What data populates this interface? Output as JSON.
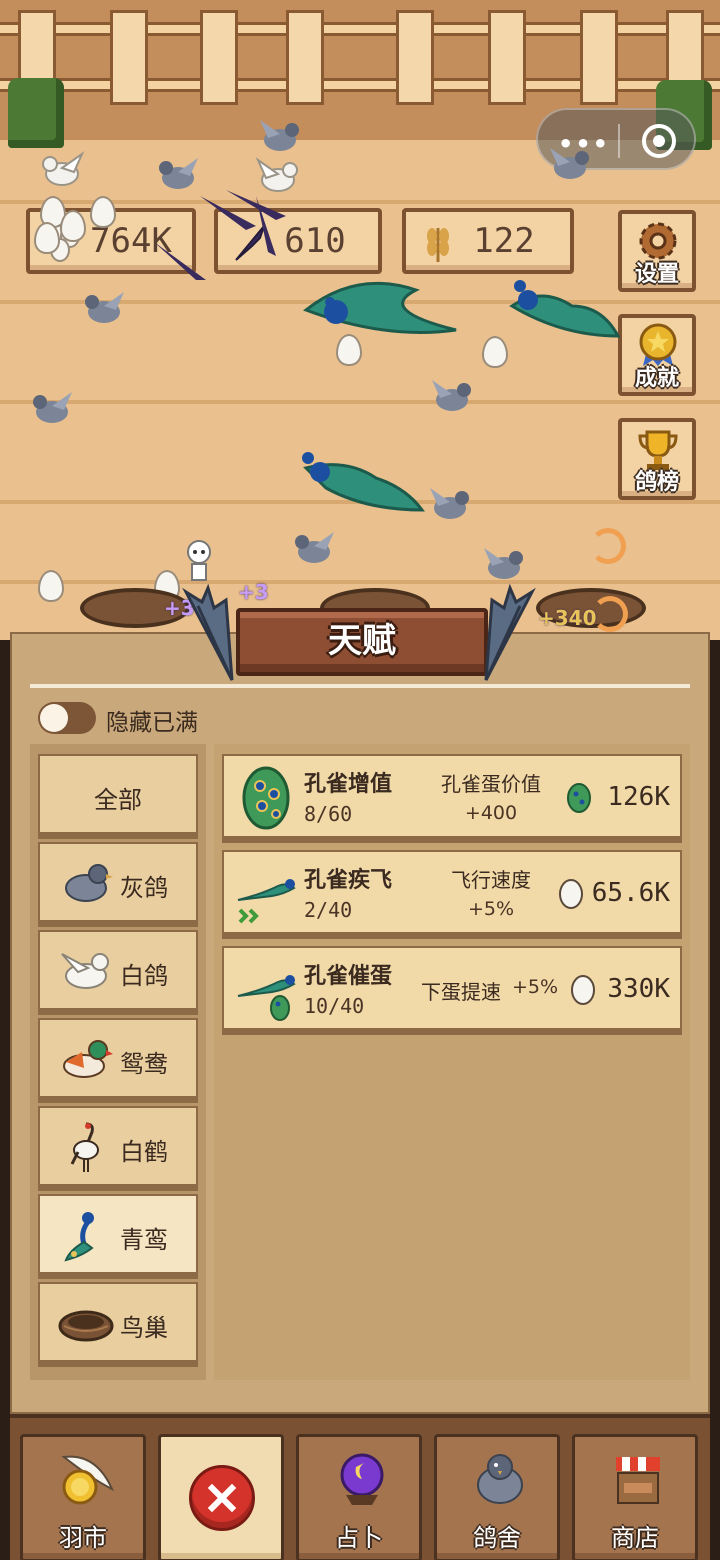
{
  "hud": {
    "eggs": "764K",
    "feathers": "610",
    "grain": "122"
  },
  "side_buttons": {
    "settings": "设置",
    "achievements": "成就",
    "leaderboard": "鸽榜"
  },
  "scene": {
    "floating_texts": [
      "+30",
      "+3",
      "+340"
    ]
  },
  "panel": {
    "title": "天赋",
    "hide_full_label": "隐藏已满",
    "categories": [
      {
        "label": "全部"
      },
      {
        "label": "灰鸽"
      },
      {
        "label": "白鸽"
      },
      {
        "label": "鸳鸯"
      },
      {
        "label": "白鹤"
      },
      {
        "label": "青鸾"
      },
      {
        "label": "鸟巢"
      }
    ],
    "talents": [
      {
        "name": "孔雀增值",
        "level": "8/60",
        "effect": "孔雀蛋价值",
        "effect_value": "+400",
        "price": "126K",
        "price_icon": "peacock-egg-icon"
      },
      {
        "name": "孔雀疾飞",
        "level": "2/40",
        "effect": "飞行速度",
        "effect_value": "+5%",
        "price": "65.6K",
        "price_icon": "egg-icon"
      },
      {
        "name": "孔雀催蛋",
        "level": "10/40",
        "effect": "下蛋提速",
        "effect_value": "+5%",
        "price": "330K",
        "price_icon": "egg-icon"
      }
    ]
  },
  "nav": {
    "feather_market": "羽市",
    "divination": "占卜",
    "dovecote": "鸽舍",
    "shop": "商店"
  },
  "colors": {
    "panel_bg": "#c9a97b",
    "banner": "#8e4e33",
    "close_red": "#d3332a",
    "peacock_green": "#2e8f7a"
  }
}
